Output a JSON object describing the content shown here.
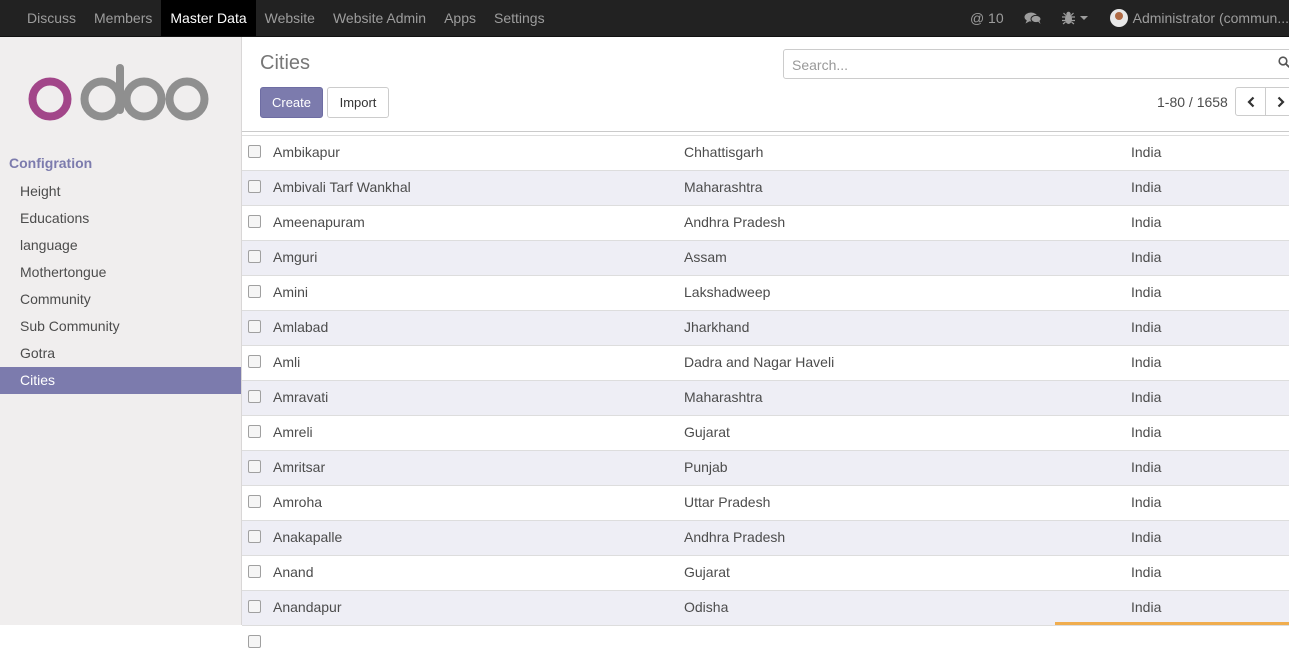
{
  "topbar": {
    "menu": [
      "Discuss",
      "Members",
      "Master Data",
      "Website",
      "Website Admin",
      "Apps",
      "Settings"
    ],
    "active_menu": "Master Data",
    "mentions": "@ 10",
    "user": "Administrator (commun..."
  },
  "sidebar": {
    "section": "Configration",
    "items": [
      "Height",
      "Educations",
      "language",
      "Mothertongue",
      "Community",
      "Sub Community",
      "Gotra",
      "Cities"
    ],
    "active_item": "Cities"
  },
  "control": {
    "title": "Cities",
    "search_placeholder": "Search...",
    "create_label": "Create",
    "import_label": "Import",
    "pager": "1-80 / 1658"
  },
  "rows": [
    {
      "name": "Ambikapur",
      "state": "Chhattisgarh",
      "country": "India"
    },
    {
      "name": "Ambivali Tarf Wankhal",
      "state": "Maharashtra",
      "country": "India"
    },
    {
      "name": "Ameenapuram",
      "state": "Andhra Pradesh",
      "country": "India"
    },
    {
      "name": "Amguri",
      "state": "Assam",
      "country": "India"
    },
    {
      "name": "Amini",
      "state": "Lakshadweep",
      "country": "India"
    },
    {
      "name": "Amlabad",
      "state": "Jharkhand",
      "country": "India"
    },
    {
      "name": "Amli",
      "state": "Dadra and Nagar Haveli",
      "country": "India"
    },
    {
      "name": "Amravati",
      "state": "Maharashtra",
      "country": "India"
    },
    {
      "name": "Amreli",
      "state": "Gujarat",
      "country": "India"
    },
    {
      "name": "Amritsar",
      "state": "Punjab",
      "country": "India"
    },
    {
      "name": "Amroha",
      "state": "Uttar Pradesh",
      "country": "India"
    },
    {
      "name": "Anakapalle",
      "state": "Andhra Pradesh",
      "country": "India"
    },
    {
      "name": "Anand",
      "state": "Gujarat",
      "country": "India"
    },
    {
      "name": "Anandapur",
      "state": "Odisha",
      "country": "India"
    },
    {
      "name": "",
      "state": "",
      "country": ""
    }
  ],
  "colors": {
    "accent": "#7c7bad",
    "topbar": "#222222",
    "logo_o": "#a24689",
    "logo_doo": "#8f8f8f"
  }
}
